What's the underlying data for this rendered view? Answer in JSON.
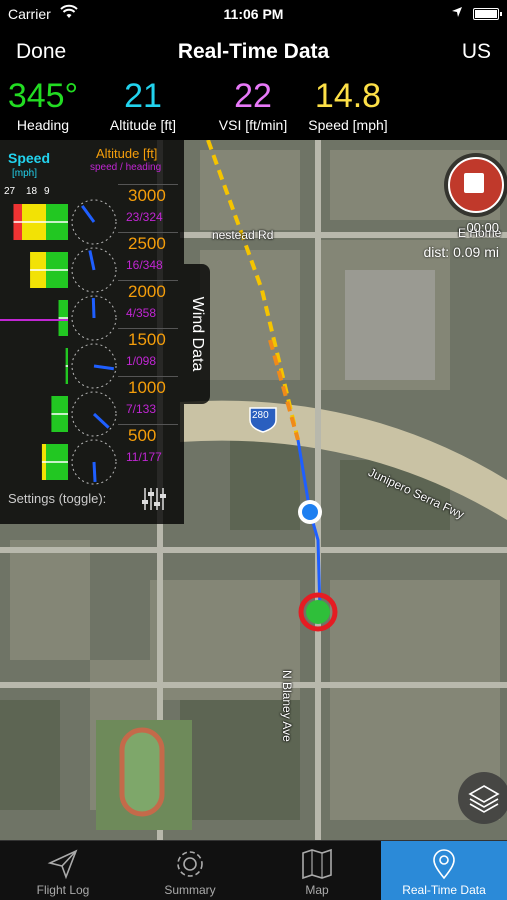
{
  "status": {
    "carrier": "Carrier",
    "time": "11:06 PM"
  },
  "nav": {
    "done_label": "Done",
    "title": "Real-Time Data",
    "units_label": "US"
  },
  "readouts": [
    {
      "value": "345°",
      "label": "Heading",
      "color": "#22dd22"
    },
    {
      "value": "21",
      "label": "Altitude [ft]",
      "color": "#22d3ee"
    },
    {
      "value": "22",
      "label": "VSI [ft/min]",
      "color": "#e879f9"
    },
    {
      "value": "14.8",
      "label": "Speed [mph]",
      "color": "#fde047"
    }
  ],
  "wind_panel": {
    "speed_title": "Speed",
    "speed_unit": "[mph]",
    "altitude_title": "Altitude [ft]",
    "altitude_sub": "speed / heading",
    "scale": [
      "27",
      "18",
      "9"
    ],
    "rows": [
      {
        "altitude": "3000",
        "wind": "23/324"
      },
      {
        "altitude": "2500",
        "wind": "16/348"
      },
      {
        "altitude": "2000",
        "wind": "4/358"
      },
      {
        "altitude": "1500",
        "wind": "1/098"
      },
      {
        "altitude": "1000",
        "wind": "7/133"
      },
      {
        "altitude": "500",
        "wind": "11/177"
      }
    ],
    "settings_label": "Settings (toggle):",
    "tab_label": "Wind Data"
  },
  "recording": {
    "timer": "00:00",
    "distance": "dist: 0.09 mi"
  },
  "map": {
    "streets": [
      "nestead Rd",
      "E Home",
      "Junipero Serra Fwy",
      "N Blaney Ave"
    ],
    "highway_shield": "280"
  },
  "tabs": [
    {
      "label": "Flight Log",
      "icon": "paper-plane-icon",
      "active": false
    },
    {
      "label": "Summary",
      "icon": "gear-icon",
      "active": false
    },
    {
      "label": "Map",
      "icon": "map-icon",
      "active": false
    },
    {
      "label": "Real-Time Data",
      "icon": "location-pin-icon",
      "active": true
    }
  ],
  "colors": {
    "altitude_text": "#f59e0b",
    "wind_text": "#c026d3",
    "accent": "#2b8ad8",
    "record": "#c0392b"
  }
}
